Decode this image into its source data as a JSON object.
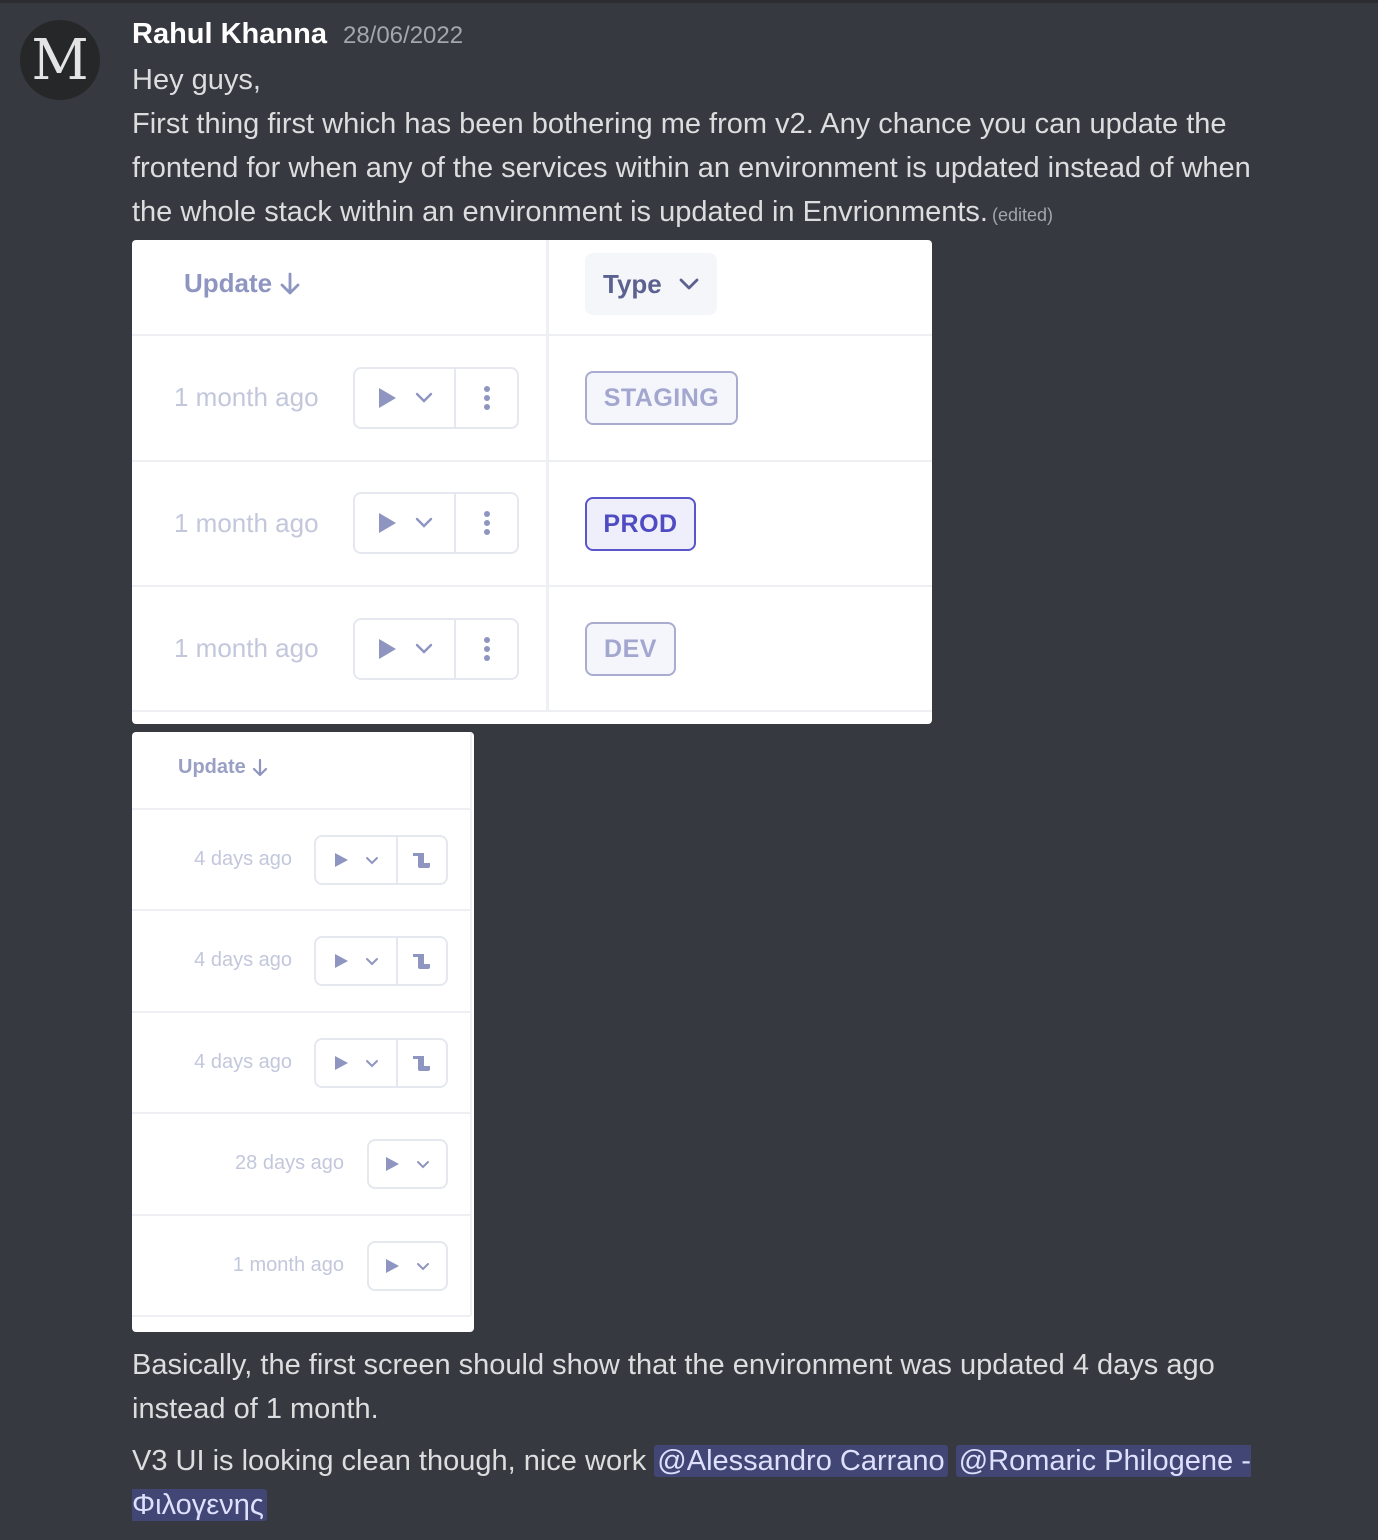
{
  "message": {
    "avatar_letter": "M",
    "author": "Rahul Khanna",
    "timestamp": "28/06/2022",
    "lines": [
      "Hey guys,",
      "First thing first which has been bothering me from v2. Any chance you can update the frontend for when any of the services within an environment is updated instead of when the whole stack within an environment is updated in Envrionments."
    ],
    "edited_label": "(edited)",
    "after_text_1": "Basically, the first screen should show that the environment was updated 4 days ago instead of 1 month.",
    "after_text_2_prefix": "V3 UI is looking clean though, nice work ",
    "mentions": [
      "@Alessandro Carrano",
      "@Romaric Philogene - Φιλογενης"
    ]
  },
  "embed_environments": {
    "columns": {
      "update": "Update",
      "update_sort_icon": "arrow-down-icon",
      "type": "Type",
      "type_icon": "chevron-down-icon"
    },
    "rows": [
      {
        "updated": "1 month ago",
        "type": "STAGING",
        "active": false
      },
      {
        "updated": "1 month ago",
        "type": "PROD",
        "active": true
      },
      {
        "updated": "1 month ago",
        "type": "DEV",
        "active": false
      }
    ],
    "actions": [
      "play-icon",
      "chevron-down-icon",
      "more-vertical-icon"
    ]
  },
  "embed_services": {
    "columns": {
      "update": "Update",
      "update_sort_icon": "arrow-down-icon"
    },
    "rows": [
      {
        "updated": "4 days ago",
        "has_logs": true
      },
      {
        "updated": "4 days ago",
        "has_logs": true
      },
      {
        "updated": "4 days ago",
        "has_logs": true
      },
      {
        "updated": "28 days ago",
        "has_logs": false
      },
      {
        "updated": "1 month ago",
        "has_logs": false
      }
    ]
  },
  "colors": {
    "background": "#36393f",
    "mention_bg": "#414675",
    "accent": "#5b55cc",
    "muted_icon": "#8e95c0"
  }
}
